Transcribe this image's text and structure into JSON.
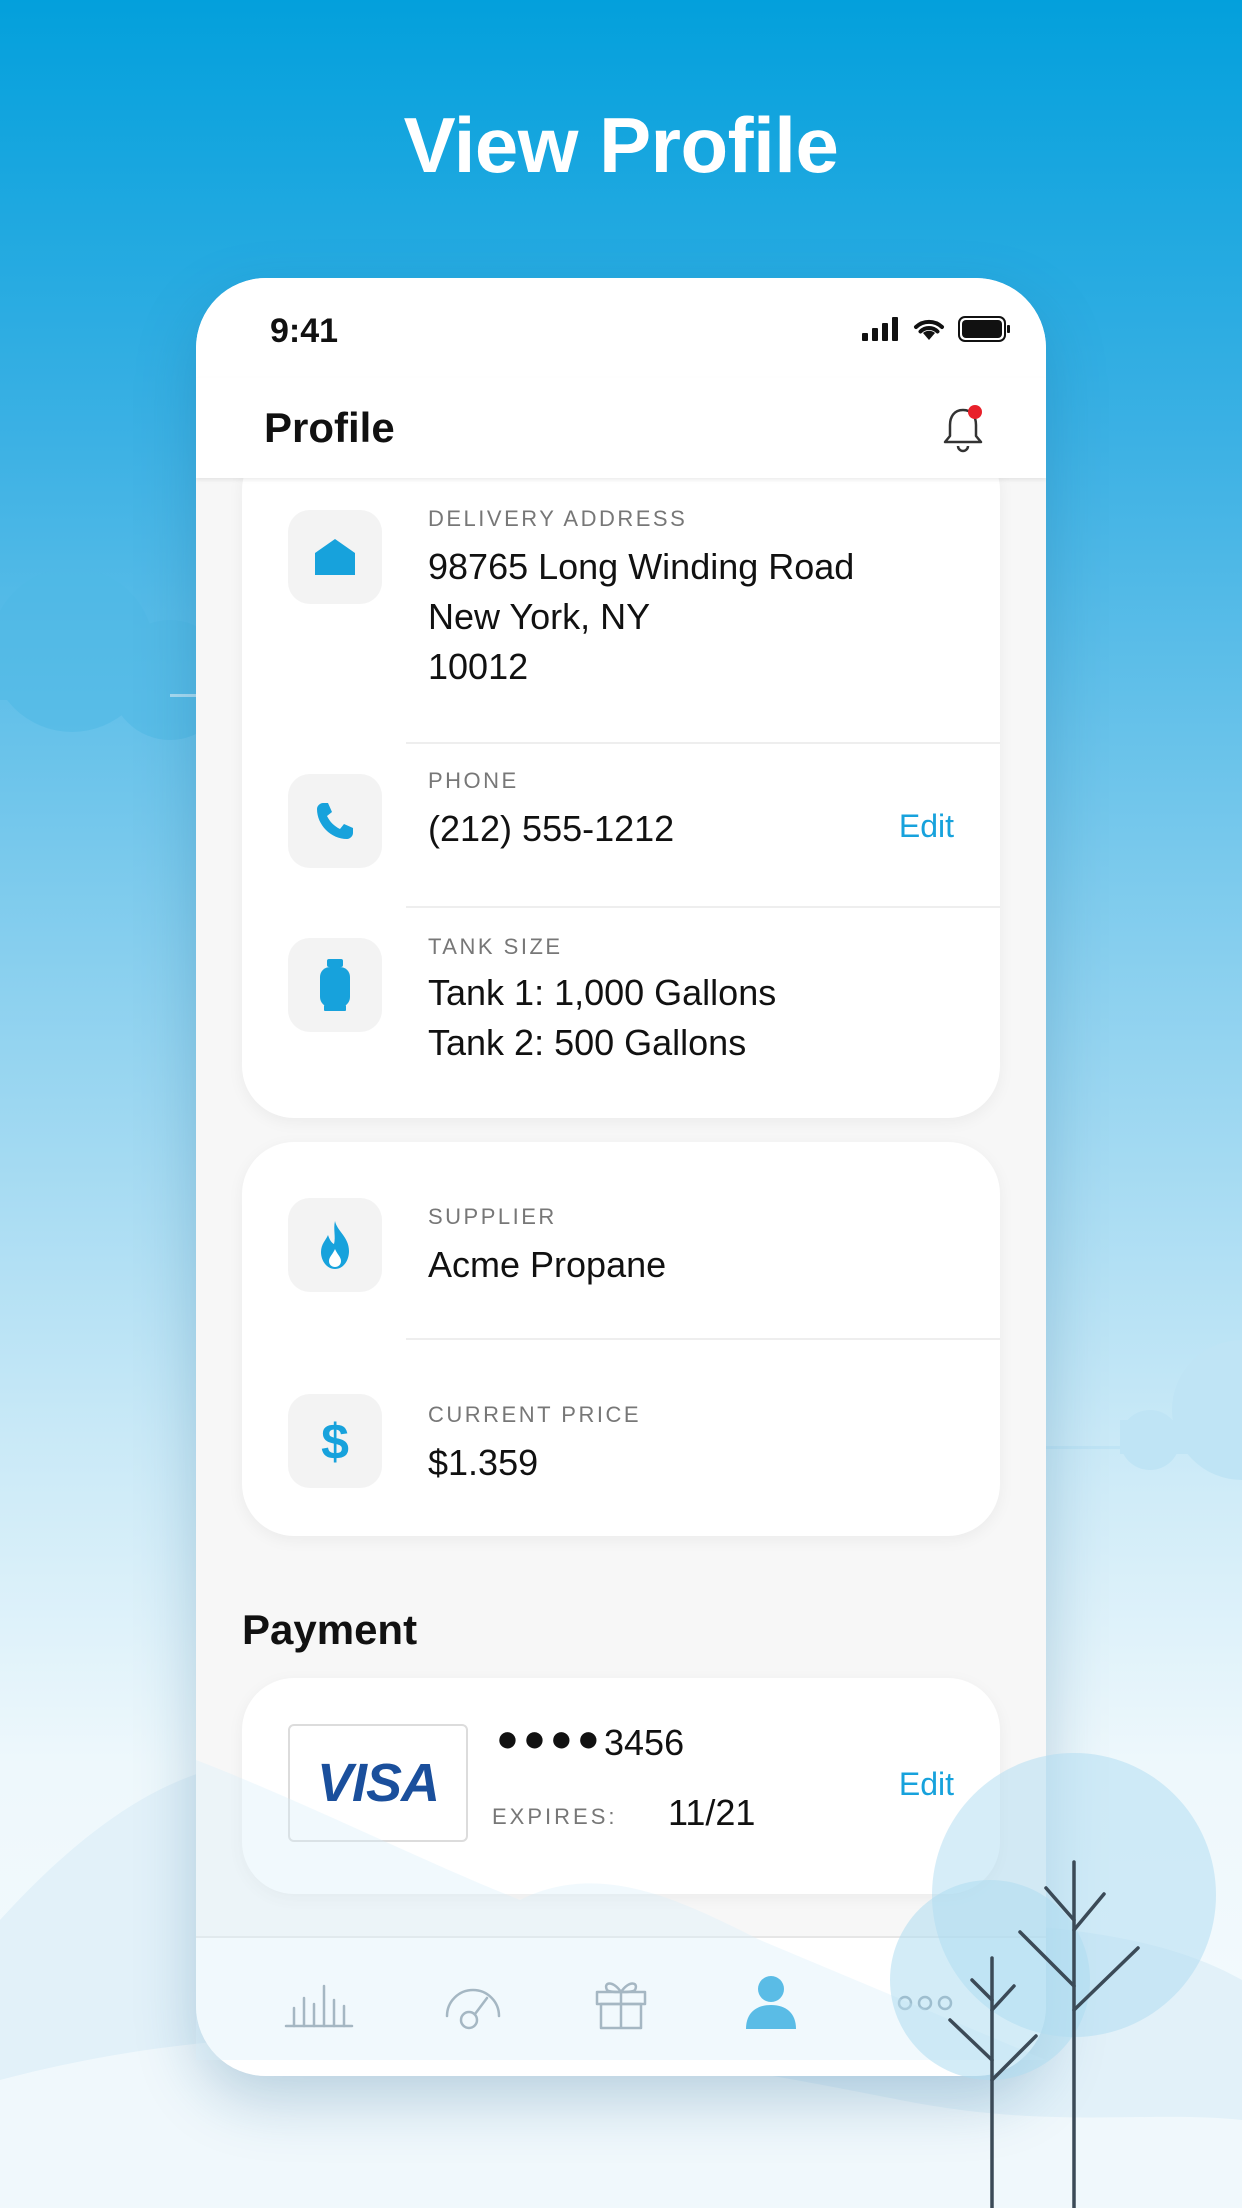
{
  "hero": {
    "title": "View Profile"
  },
  "status_bar": {
    "time": "9:41",
    "icons": [
      "signal-icon",
      "wifi-icon",
      "battery-icon"
    ]
  },
  "header": {
    "title": "Profile",
    "bell_icon": "bell-icon",
    "has_notification": true
  },
  "account_card": {
    "delivery": {
      "icon": "house-icon",
      "label": "DELIVERY ADDRESS",
      "line1": "98765 Long Winding Road",
      "line2": "New York, NY",
      "line3": "10012"
    },
    "phone": {
      "icon": "phone-icon",
      "label": "PHONE",
      "value": "(212) 555-1212",
      "edit_label": "Edit"
    },
    "tank": {
      "icon": "tank-icon",
      "label": "TANK SIZE",
      "line1": "Tank 1: 1,000 Gallons",
      "line2": "Tank 2: 500 Gallons"
    }
  },
  "supplier_card": {
    "supplier": {
      "icon": "flame-icon",
      "label": "SUPPLIER",
      "value": "Acme Propane"
    },
    "price": {
      "icon": "dollar-icon",
      "label": "CURRENT PRICE",
      "value": "$1.359"
    }
  },
  "payment": {
    "section_title": "Payment",
    "card_brand": "VISA",
    "masked": "●●●●",
    "last4": "3456",
    "expires_label": "EXPIRES:",
    "expires_value": "11/21",
    "edit_label": "Edit"
  },
  "tabs": [
    {
      "name": "usage",
      "icon": "bar-chart-icon",
      "active": false
    },
    {
      "name": "gauge",
      "icon": "gauge-icon",
      "active": false
    },
    {
      "name": "rewards",
      "icon": "gift-icon",
      "active": false
    },
    {
      "name": "profile",
      "icon": "person-icon",
      "active": true
    },
    {
      "name": "more",
      "icon": "more-icon",
      "active": false
    }
  ],
  "colors": {
    "accent": "#17a2dc",
    "sky_top": "#03a0dc",
    "notification": "#e8202a",
    "visa_blue": "#1a4f9c",
    "visa_gold": "#f2a900"
  }
}
